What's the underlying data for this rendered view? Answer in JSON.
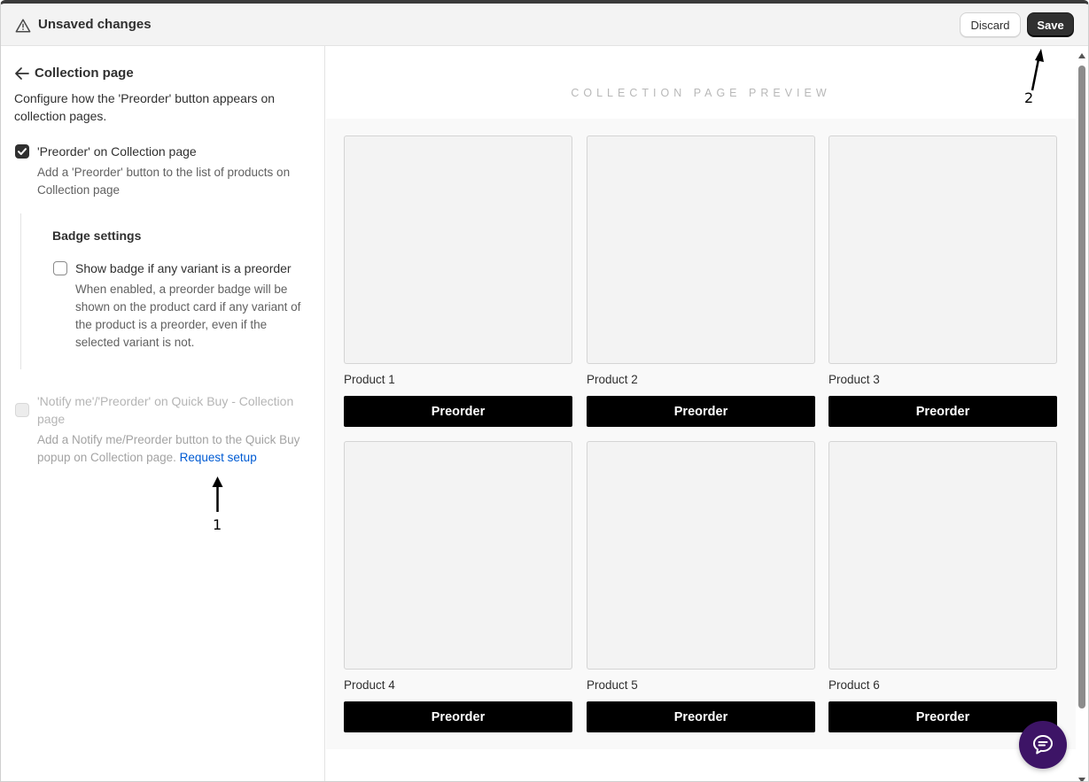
{
  "header": {
    "title": "Unsaved changes",
    "discard_label": "Discard",
    "save_label": "Save"
  },
  "sidebar": {
    "back_label": "Collection page",
    "description": "Configure how the 'Preorder' button appears on collection pages.",
    "option_preorder": {
      "label": "'Preorder' on Collection page",
      "help": "Add a 'Preorder' button to the list of products on Collection page",
      "checked": true
    },
    "badge_settings": {
      "title": "Badge settings",
      "label": "Show badge if any variant is a preorder",
      "help": "When enabled, a preorder badge will be shown on the product card if any variant of the product is a preorder, even if the selected variant is not.",
      "checked": false
    },
    "option_quickbuy": {
      "label": "'Notify me'/'Preorder' on Quick Buy - Collection page",
      "help": "Add a Notify me/Preorder button to the Quick Buy popup on Collection page.",
      "link": "Request setup",
      "disabled": true
    }
  },
  "preview": {
    "title": "COLLECTION PAGE PREVIEW",
    "products": [
      {
        "name": "Product 1",
        "button": "Preorder"
      },
      {
        "name": "Product 2",
        "button": "Preorder"
      },
      {
        "name": "Product 3",
        "button": "Preorder"
      },
      {
        "name": "Product 4",
        "button": "Preorder"
      },
      {
        "name": "Product 5",
        "button": "Preorder"
      },
      {
        "name": "Product 6",
        "button": "Preorder"
      }
    ]
  },
  "annotations": {
    "a1": "1",
    "a2": "2"
  },
  "icons": {
    "warning": "warning-icon",
    "back": "arrow-left-icon",
    "chat": "chat-icon"
  },
  "colors": {
    "primary_button": "#303030",
    "link": "#005bd3",
    "chat_bubble": "#3d1466",
    "preorder_button": "#000000"
  }
}
